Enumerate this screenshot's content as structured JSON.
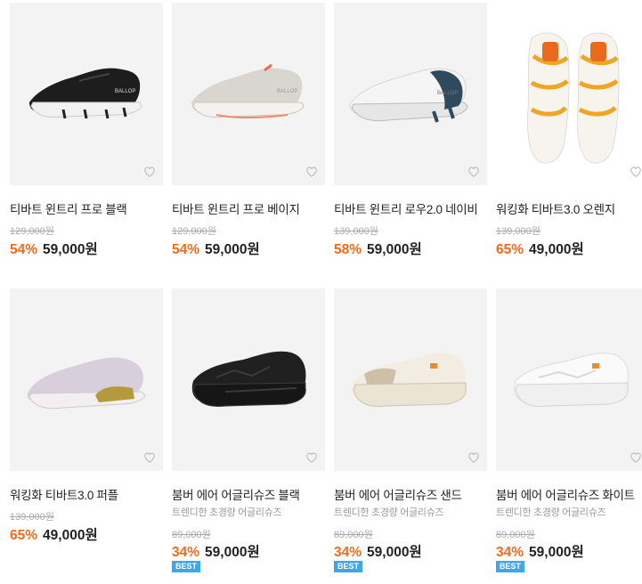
{
  "colors": {
    "discount": "#f26b1d",
    "badge": "#3aa7f0",
    "thumb_bg": "#f3f3f3"
  },
  "products": [
    {
      "name": "티바트 윈트리 프로 블랙",
      "original_price": "129,000원",
      "discount": "54%",
      "price": "59,000원",
      "image": "black-running-shoe",
      "wish_icon": "heart-outline-icon"
    },
    {
      "name": "티바트 윈트리 프로 베이지",
      "original_price": "129,000원",
      "discount": "54%",
      "price": "59,000원",
      "image": "beige-running-shoe",
      "wish_icon": "heart-outline-icon"
    },
    {
      "name": "티바트 윈트리 로우2.0 네이비",
      "original_price": "139,000원",
      "discount": "58%",
      "price": "59,000원",
      "image": "white-navy-running-shoe",
      "wish_icon": "heart-outline-icon"
    },
    {
      "name": "워킹화 티바트3.0 오렌지",
      "original_price": "139,000원",
      "discount": "65%",
      "price": "49,000원",
      "image": "white-orange-shoes-top-view",
      "wish_icon": "heart-outline-icon"
    },
    {
      "name": "워킹화 티바트3.0 퍼플",
      "original_price": "139,000원",
      "discount": "65%",
      "price": "49,000원",
      "image": "purple-knit-shoe",
      "wish_icon": "heart-outline-icon"
    },
    {
      "name": "붐버 에어 어글리슈즈 블랙",
      "subtitle": "트렌디한 초경량 어글리슈즈",
      "original_price": "89,000원",
      "discount": "34%",
      "price": "59,000원",
      "badge": "BEST",
      "image": "black-chunky-sneaker",
      "wish_icon": "heart-outline-icon"
    },
    {
      "name": "붐버 에어 어글리슈즈 샌드",
      "subtitle": "트렌디한 초경량 어글리슈즈",
      "original_price": "89,000원",
      "discount": "34%",
      "price": "59,000원",
      "badge": "BEST",
      "image": "sand-chunky-sneaker",
      "wish_icon": "heart-outline-icon"
    },
    {
      "name": "붐버 에어 어글리슈즈 화이트",
      "subtitle": "트렌디한 초경량 어글리슈즈",
      "original_price": "89,000원",
      "discount": "34%",
      "price": "59,000원",
      "badge": "BEST",
      "image": "white-chunky-sneaker",
      "wish_icon": "heart-outline-icon"
    }
  ]
}
